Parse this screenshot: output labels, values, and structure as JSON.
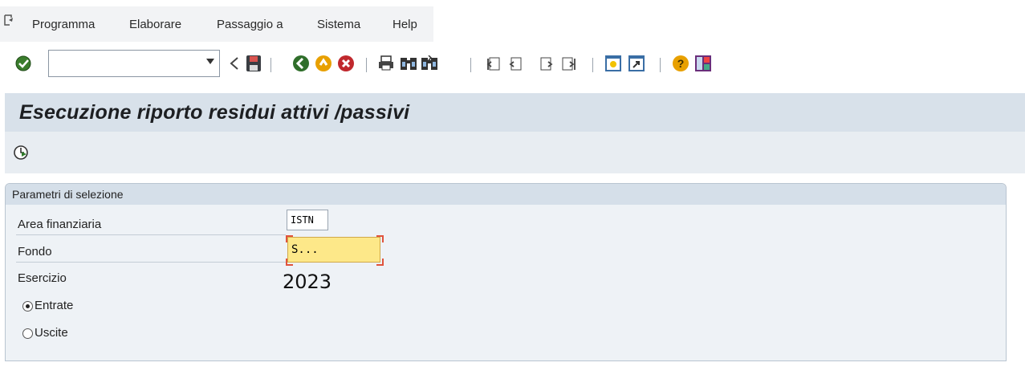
{
  "menubar": {
    "items": [
      {
        "label": "Programma"
      },
      {
        "label": "Elaborare"
      },
      {
        "label": "Passaggio a"
      },
      {
        "label": "Sistema"
      },
      {
        "label": "Help"
      }
    ]
  },
  "toolbar": {
    "command_field": {
      "value": "",
      "placeholder": ""
    },
    "icons": [
      "enter-check-icon",
      "back-nav-icon",
      "save-icon",
      "back-icon",
      "exit-icon",
      "cancel-icon",
      "print-icon",
      "find-icon",
      "find-next-icon",
      "first-page-icon",
      "previous-page-icon",
      "next-page-icon",
      "last-page-icon",
      "create-session-icon",
      "shortcut-icon",
      "help-icon",
      "layout-icon"
    ]
  },
  "page": {
    "title": "Esecuzione riporto residui attivi /passivi"
  },
  "selection": {
    "title": "Parametri di selezione",
    "fields": {
      "area_label": "Area finanziaria",
      "area_value": "ISTN",
      "fondo_label": "Fondo",
      "fondo_value": "S...",
      "esercizio_label": "Esercizio",
      "esercizio_value": "2023"
    },
    "radios": [
      {
        "label": "Entrate",
        "checked": true
      },
      {
        "label": "Uscite",
        "checked": false
      }
    ]
  },
  "colors": {
    "title_band": "#d8e1ea",
    "group_bg": "#eef2f6",
    "focus_field": "#fde889",
    "focus_corner": "#e0533c"
  }
}
